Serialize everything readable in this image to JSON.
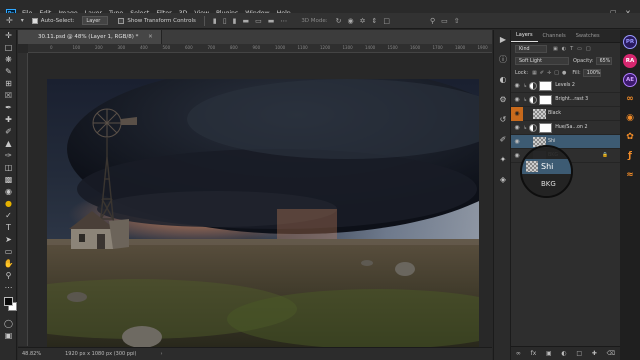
{
  "app": {
    "logo": "Ps",
    "menu": [
      "File",
      "Edit",
      "Image",
      "Layer",
      "Type",
      "Select",
      "Filter",
      "3D",
      "View",
      "Plugins",
      "Window",
      "Help"
    ]
  },
  "options_bar": {
    "auto_select_label": "Auto-Select:",
    "auto_select_value": "Layer",
    "show_transform_label": "Show Transform Controls",
    "mode_3d_label": "3D Mode:"
  },
  "document": {
    "tab_title": "30.11.psd @ 48% (Layer 1, RGB/8) *",
    "zoom": "48.82%",
    "dimensions": "1920 px x 1080 px (300 ppi)",
    "ruler_ticks": [
      "0",
      "100",
      "200",
      "300",
      "400",
      "500",
      "600",
      "700",
      "800",
      "900",
      "1000",
      "1100",
      "1200",
      "1300",
      "1400",
      "1500",
      "1600",
      "1700",
      "1800",
      "1900"
    ]
  },
  "layers_panel": {
    "tabs": [
      "Layers",
      "Channels",
      "Swatches"
    ],
    "filter_kind": "Kind",
    "blend_mode": "Soft Light",
    "opacity_label": "Opacity:",
    "opacity_value": "65%",
    "lock_label": "Lock:",
    "fill_label": "Fill:",
    "fill_value": "100%",
    "layers": [
      {
        "name": "Levels 2",
        "type": "adjustment"
      },
      {
        "name": "Bright...rast 3",
        "type": "adjustment"
      },
      {
        "name": "Black",
        "type": "pixel"
      },
      {
        "name": "Hue/Sa...on 2",
        "type": "adjustment"
      },
      {
        "name": "Shi",
        "type": "pixel",
        "selected": true
      },
      {
        "name": "BKG",
        "type": "background"
      }
    ],
    "magnifier_text": "Shi",
    "magnifier_text_2": "BKG"
  },
  "cc_apps": [
    "PR",
    "RA",
    "AE",
    "",
    "",
    "",
    "",
    ""
  ],
  "colors": {
    "accent": "#31a8ff",
    "selection": "#3d5b73",
    "app_pr": "#9999ff",
    "app_ra": "#d6276f",
    "app_ae": "#b07cff",
    "app_orange": "#f28c28"
  }
}
